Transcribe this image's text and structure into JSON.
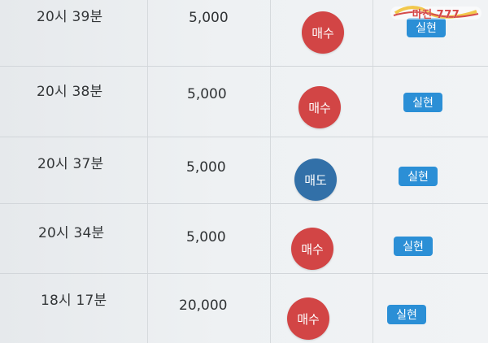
{
  "watermark": {
    "text": "마진 777"
  },
  "rows": [
    {
      "time": "20시 39분",
      "amount": "5,000",
      "type": "매수",
      "status": "실현"
    },
    {
      "time": "20시 38분",
      "amount": "5,000",
      "type": "매수",
      "status": "실현"
    },
    {
      "time": "20시 37분",
      "amount": "5,000",
      "type": "매도",
      "status": "실현"
    },
    {
      "time": "20시 34분",
      "amount": "5,000",
      "type": "매수",
      "status": "실현"
    },
    {
      "time": "18시 17분",
      "amount": "20,000",
      "type": "매수",
      "status": "실현"
    }
  ],
  "colors": {
    "buy": "#d24545",
    "sell": "#3270a8",
    "status": "#2b8fd6"
  }
}
